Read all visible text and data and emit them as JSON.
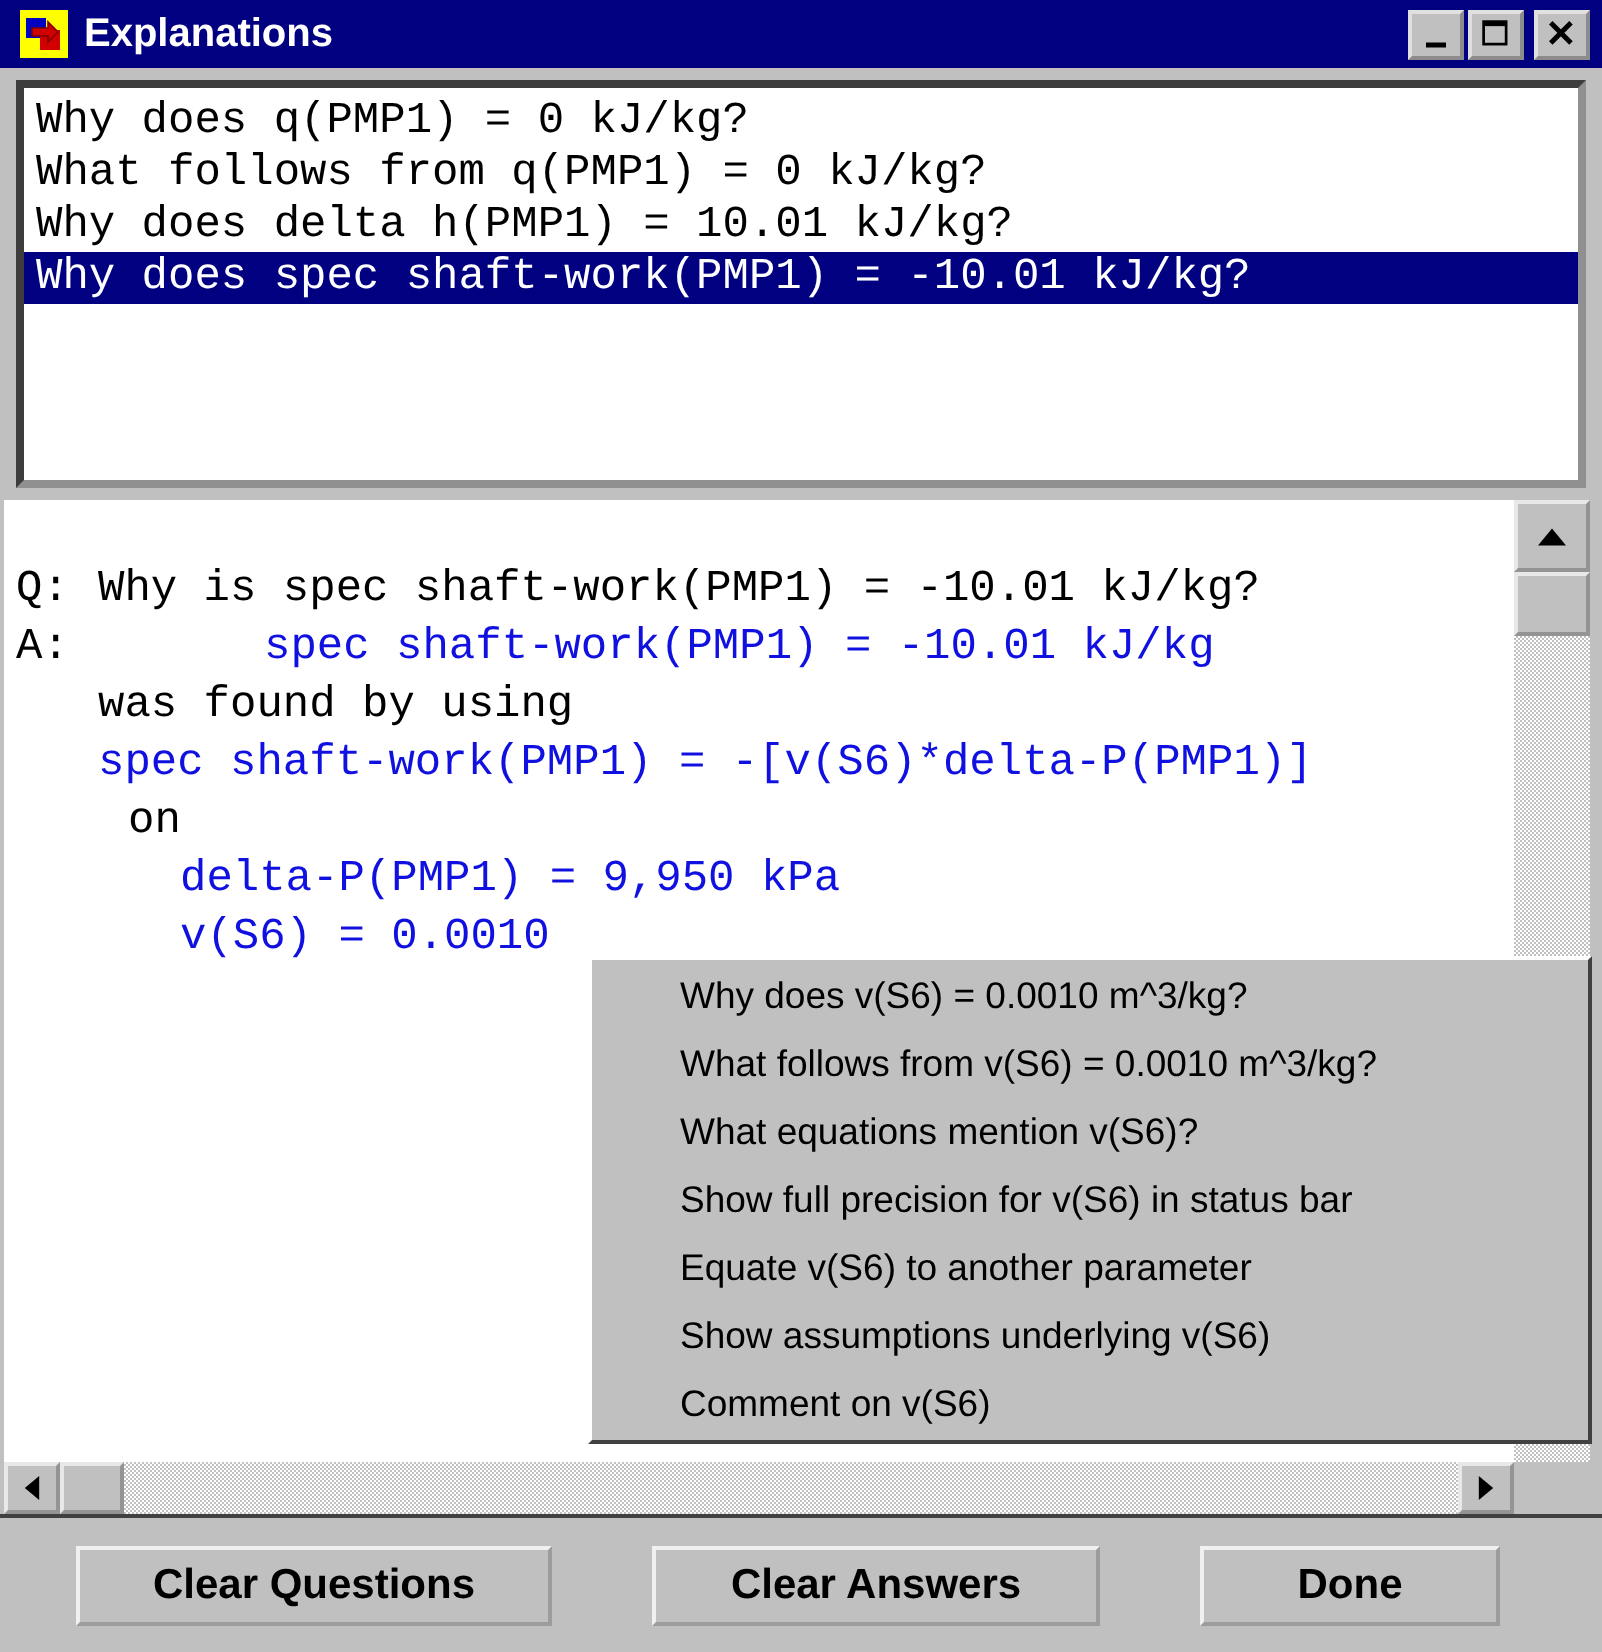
{
  "window": {
    "title": "Explanations"
  },
  "questions": [
    {
      "text": "Why does q(PMP1) = 0 kJ/kg?",
      "selected": false
    },
    {
      "text": "What follows from q(PMP1) = 0 kJ/kg?",
      "selected": false
    },
    {
      "text": "Why does delta h(PMP1) = 10.01 kJ/kg?",
      "selected": false
    },
    {
      "text": "Why does spec shaft-work(PMP1) = -10.01 kJ/kg?",
      "selected": true
    }
  ],
  "answer": {
    "lines": [
      {
        "kind": "question",
        "prefix": "Q:",
        "text": "Why is spec shaft-work(PMP1) = -10.01 kJ/kg?"
      },
      {
        "kind": "answer",
        "prefix": "A:",
        "text": "spec shaft-work(PMP1) = -10.01 kJ/kg"
      },
      {
        "kind": "note",
        "text": "was found by using"
      },
      {
        "kind": "equation",
        "text": "spec shaft-work(PMP1) = -[v(S6)*delta-P(PMP1)]"
      },
      {
        "kind": "connector",
        "text": "on"
      },
      {
        "kind": "input",
        "text": "delta-P(PMP1) = 9,950 kPa"
      },
      {
        "kind": "input",
        "text": "v(S6) = 0.0010"
      }
    ]
  },
  "context_menu": {
    "items": [
      "Why does v(S6) = 0.0010 m^3/kg?",
      "What follows from v(S6) = 0.0010 m^3/kg?",
      "What equations mention v(S6)?",
      "Show full precision for v(S6) in status bar",
      "Equate v(S6) to another parameter",
      "Show assumptions underlying v(S6)",
      "Comment on v(S6)"
    ]
  },
  "buttons": [
    "Clear Questions",
    "Clear Answers",
    "Done"
  ]
}
